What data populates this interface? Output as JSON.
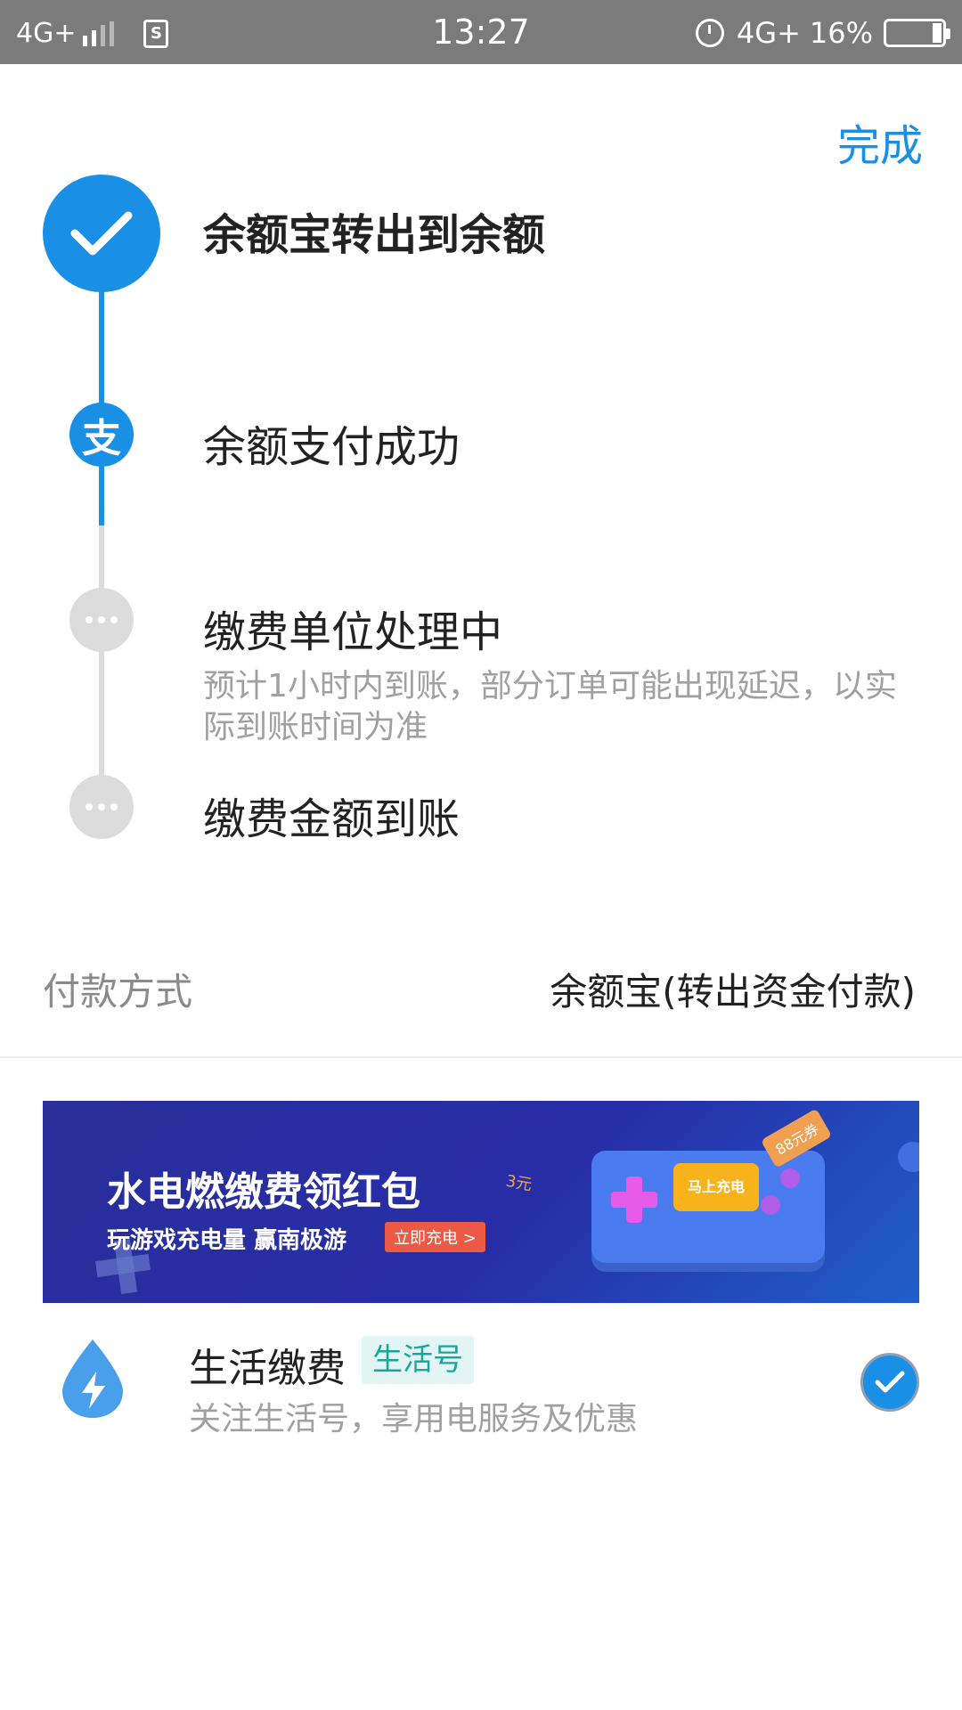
{
  "status_bar": {
    "network": "4G+",
    "sim_label": "S",
    "time": "13:27",
    "network_right": "4G+",
    "battery_percent": "16%",
    "battery_level": 0.16
  },
  "header": {
    "done_label": "完成"
  },
  "steps": [
    {
      "title": "余额宝转出到余额",
      "state": "done"
    },
    {
      "title": "余额支付成功",
      "state": "done",
      "icon_char": "支"
    },
    {
      "title": "缴费单位处理中",
      "state": "pending",
      "desc": "预计1小时内到账，部分订单可能出现延迟，以实际到账时间为准"
    },
    {
      "title": "缴费金额到账",
      "state": "pending"
    }
  ],
  "payment": {
    "label": "付款方式",
    "value": "余额宝(转出资金付款)"
  },
  "banner": {
    "title": "水电燃缴费领红包",
    "subtitle": "玩游戏充电量 赢南极游",
    "button_label": "立即充电 >",
    "console_label": "马上充电",
    "tag_88": "88元券",
    "tag_3": "3元"
  },
  "life_service": {
    "title": "生活缴费",
    "badge": "生活号",
    "desc": "关注生活号，享用电服务及优惠",
    "checked": true
  },
  "colors": {
    "accent": "#1a8fe6",
    "pending": "#dcdcdc",
    "status_bar": "#7b7b7b",
    "badge_text": "#18a89b"
  }
}
